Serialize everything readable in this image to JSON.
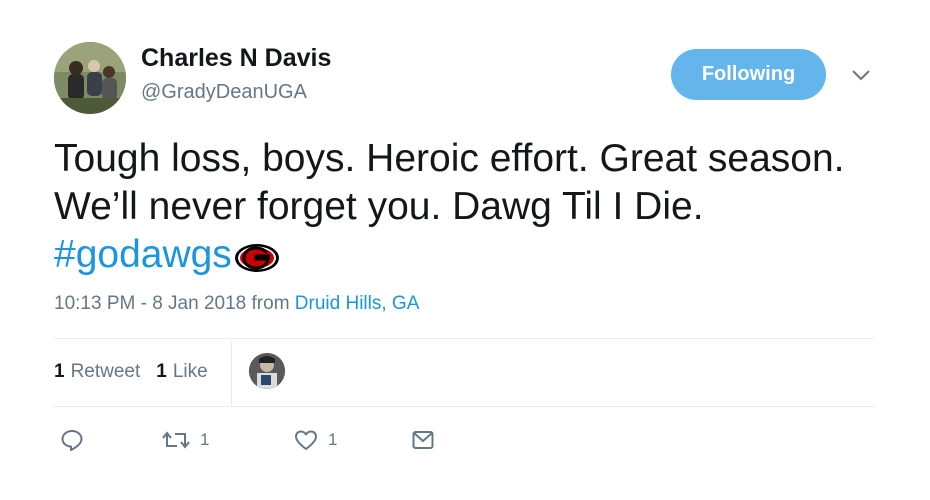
{
  "user": {
    "name": "Charles N Davis",
    "handle": "@GradyDeanUGA",
    "follow_label": "Following"
  },
  "tweet": {
    "text": "Tough loss, boys. Heroic effort. Great season. We’ll never forget you. Dawg Til I Die.",
    "hashtag": "#godawgs",
    "time": "10:13 PM - 8 Jan 2018 from ",
    "location": "Druid Hills, GA"
  },
  "stats": {
    "retweets_count": "1",
    "retweets_label": "Retweet",
    "likes_count": "1",
    "likes_label": "Like"
  },
  "actions": {
    "retweet_count": "1",
    "like_count": "1"
  },
  "colors": {
    "link": "#1b95e0",
    "button": "#63b5ec",
    "muted": "#657786"
  }
}
